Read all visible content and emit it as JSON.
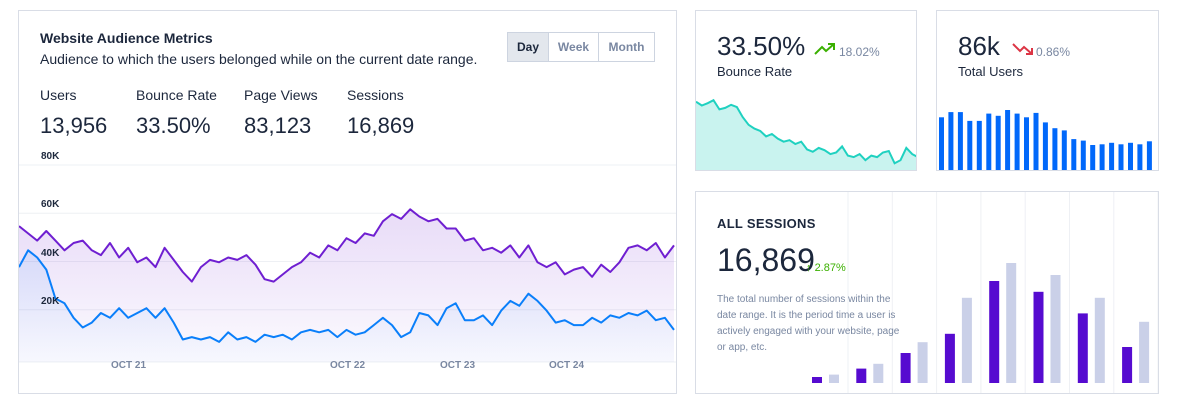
{
  "audience": {
    "title": "Website Audience Metrics",
    "subtitle": "Audience to which the users belonged while on the current date range.",
    "periods": [
      "Day",
      "Week",
      "Month"
    ],
    "active_period": "Day",
    "metrics": [
      {
        "label": "Users",
        "value": "13,956"
      },
      {
        "label": "Bounce Rate",
        "value": "33.50%"
      },
      {
        "label": "Page Views",
        "value": "83,123"
      },
      {
        "label": "Sessions",
        "value": "16,869"
      }
    ]
  },
  "bounce_card": {
    "value": "33.50%",
    "delta": "18.02%",
    "trend": "up",
    "label": "Bounce Rate",
    "color_up": "#3bb001",
    "fill_color": "#c9f3ef",
    "line_color": "#1fd1c0"
  },
  "users_card": {
    "value": "86k",
    "delta": "0.86%",
    "trend": "down",
    "label": "Total Users",
    "color_down": "#dc3545",
    "bar_color": "#0168fa"
  },
  "sessions_card": {
    "title": "ALL SESSIONS",
    "value": "16,869",
    "delta": "2.87%",
    "trend": "up",
    "description": "The total number of sessions within the date range. It is the period time a user is actively engaged with your website, page or app, etc.",
    "primary_color": "#560bd0",
    "secondary_color": "#cad0e8"
  },
  "chart_data": [
    {
      "type": "area",
      "name": "audience-metrics",
      "y_ticks": [
        "80K",
        "60K",
        "40K",
        "20K"
      ],
      "y_tick_values": [
        80000,
        60000,
        40000,
        20000
      ],
      "ylim": [
        0,
        80000
      ],
      "x_tick_labels": [
        {
          "label": "OCT 21",
          "index": 12
        },
        {
          "label": "OCT 22",
          "index": 40
        },
        {
          "label": "OCT 23",
          "index": 54
        },
        {
          "label": "OCT 24",
          "index": 68
        }
      ],
      "series": [
        {
          "color": "#6f1fd1",
          "values": [
            53000,
            50000,
            47000,
            51000,
            47000,
            43000,
            46000,
            47000,
            43000,
            41000,
            46000,
            40000,
            44000,
            38000,
            40000,
            36000,
            44000,
            39000,
            34000,
            30000,
            36000,
            39000,
            38000,
            40000,
            39000,
            41000,
            37000,
            31000,
            30000,
            33000,
            36000,
            38000,
            42000,
            40000,
            45000,
            43000,
            48000,
            46000,
            50000,
            49000,
            55000,
            58000,
            56000,
            60000,
            57000,
            55000,
            56000,
            52000,
            52000,
            47000,
            48000,
            43000,
            44000,
            42000,
            45000,
            40000,
            45000,
            38000,
            36000,
            38000,
            33000,
            35000,
            36000,
            32000,
            37000,
            34000,
            38000,
            44000,
            45000,
            43000,
            46000,
            40000,
            45000
          ]
        },
        {
          "color": "#0a7ffa",
          "values": [
            36000,
            43000,
            40000,
            35000,
            23000,
            21000,
            15000,
            11000,
            13000,
            17000,
            15000,
            19000,
            15000,
            17000,
            19000,
            15000,
            19000,
            13000,
            6000,
            7000,
            6000,
            7000,
            5000,
            9000,
            6000,
            7000,
            5000,
            8000,
            7000,
            8000,
            6000,
            9000,
            10000,
            9000,
            10000,
            7000,
            10000,
            8000,
            9000,
            12000,
            15000,
            12000,
            7000,
            9000,
            17000,
            16000,
            12000,
            19000,
            21000,
            14000,
            14000,
            16000,
            12000,
            18000,
            22000,
            20000,
            25000,
            22000,
            18000,
            13000,
            14000,
            12000,
            12000,
            15000,
            13000,
            16000,
            15000,
            17000,
            16000,
            18000,
            14000,
            15000,
            10000
          ]
        }
      ]
    },
    {
      "type": "area",
      "name": "bounce-rate-sparkline",
      "ylim": [
        0,
        100
      ],
      "values": [
        90,
        85,
        88,
        92,
        80,
        82,
        86,
        83,
        70,
        60,
        55,
        52,
        45,
        48,
        42,
        38,
        40,
        35,
        38,
        28,
        25,
        30,
        27,
        22,
        24,
        32,
        20,
        18,
        22,
        14,
        20,
        18,
        24,
        26,
        10,
        14,
        30,
        22,
        18
      ]
    },
    {
      "type": "bar",
      "name": "total-users-sparkline",
      "ylim": [
        0,
        100
      ],
      "values": [
        75,
        82,
        82,
        70,
        70,
        80,
        77,
        85,
        80,
        75,
        81,
        68,
        60,
        57,
        45,
        43,
        37,
        38,
        40,
        38,
        40,
        38,
        42
      ]
    },
    {
      "type": "bar",
      "name": "all-sessions",
      "ylim": [
        0,
        100
      ],
      "series": [
        {
          "values": [
            5,
            12,
            25,
            41,
            85,
            76,
            58,
            30
          ]
        },
        {
          "values": [
            7,
            16,
            34,
            71,
            100,
            90,
            71,
            51
          ]
        }
      ]
    }
  ]
}
